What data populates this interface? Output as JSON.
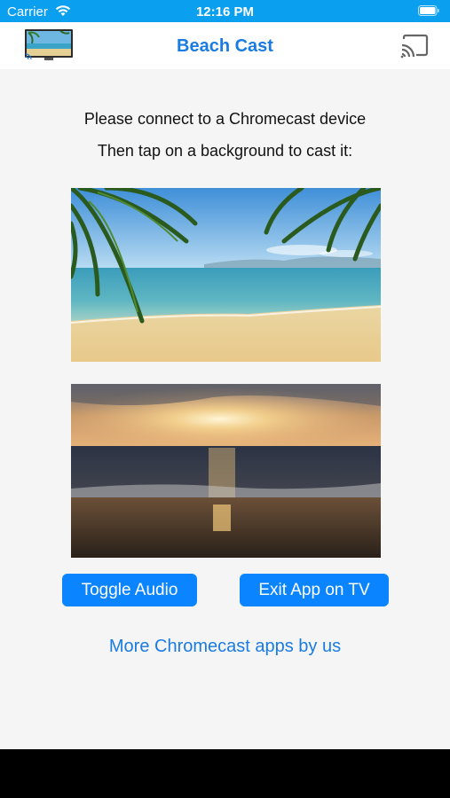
{
  "status_bar": {
    "carrier": "Carrier",
    "time": "12:16 PM",
    "icons": [
      "wifi-icon",
      "battery-icon"
    ]
  },
  "nav": {
    "title": "Beach Cast",
    "left_icon": "tv-thumbnail-icon",
    "right_icon": "cast-icon"
  },
  "main": {
    "instruction_line1": "Please connect to a Chromecast device",
    "instruction_line2": "Then tap on a background to cast it:",
    "backgrounds": [
      "tropical-beach-image",
      "sunset-beach-image"
    ],
    "toggle_audio_label": "Toggle Audio",
    "exit_app_label": "Exit App on TV",
    "more_apps_link": "More Chromecast apps by us"
  },
  "colors": {
    "status_bar": "#0b9ff0",
    "accent": "#1a7be0",
    "button": "#0a84ff",
    "background": "#f5f5f5"
  }
}
